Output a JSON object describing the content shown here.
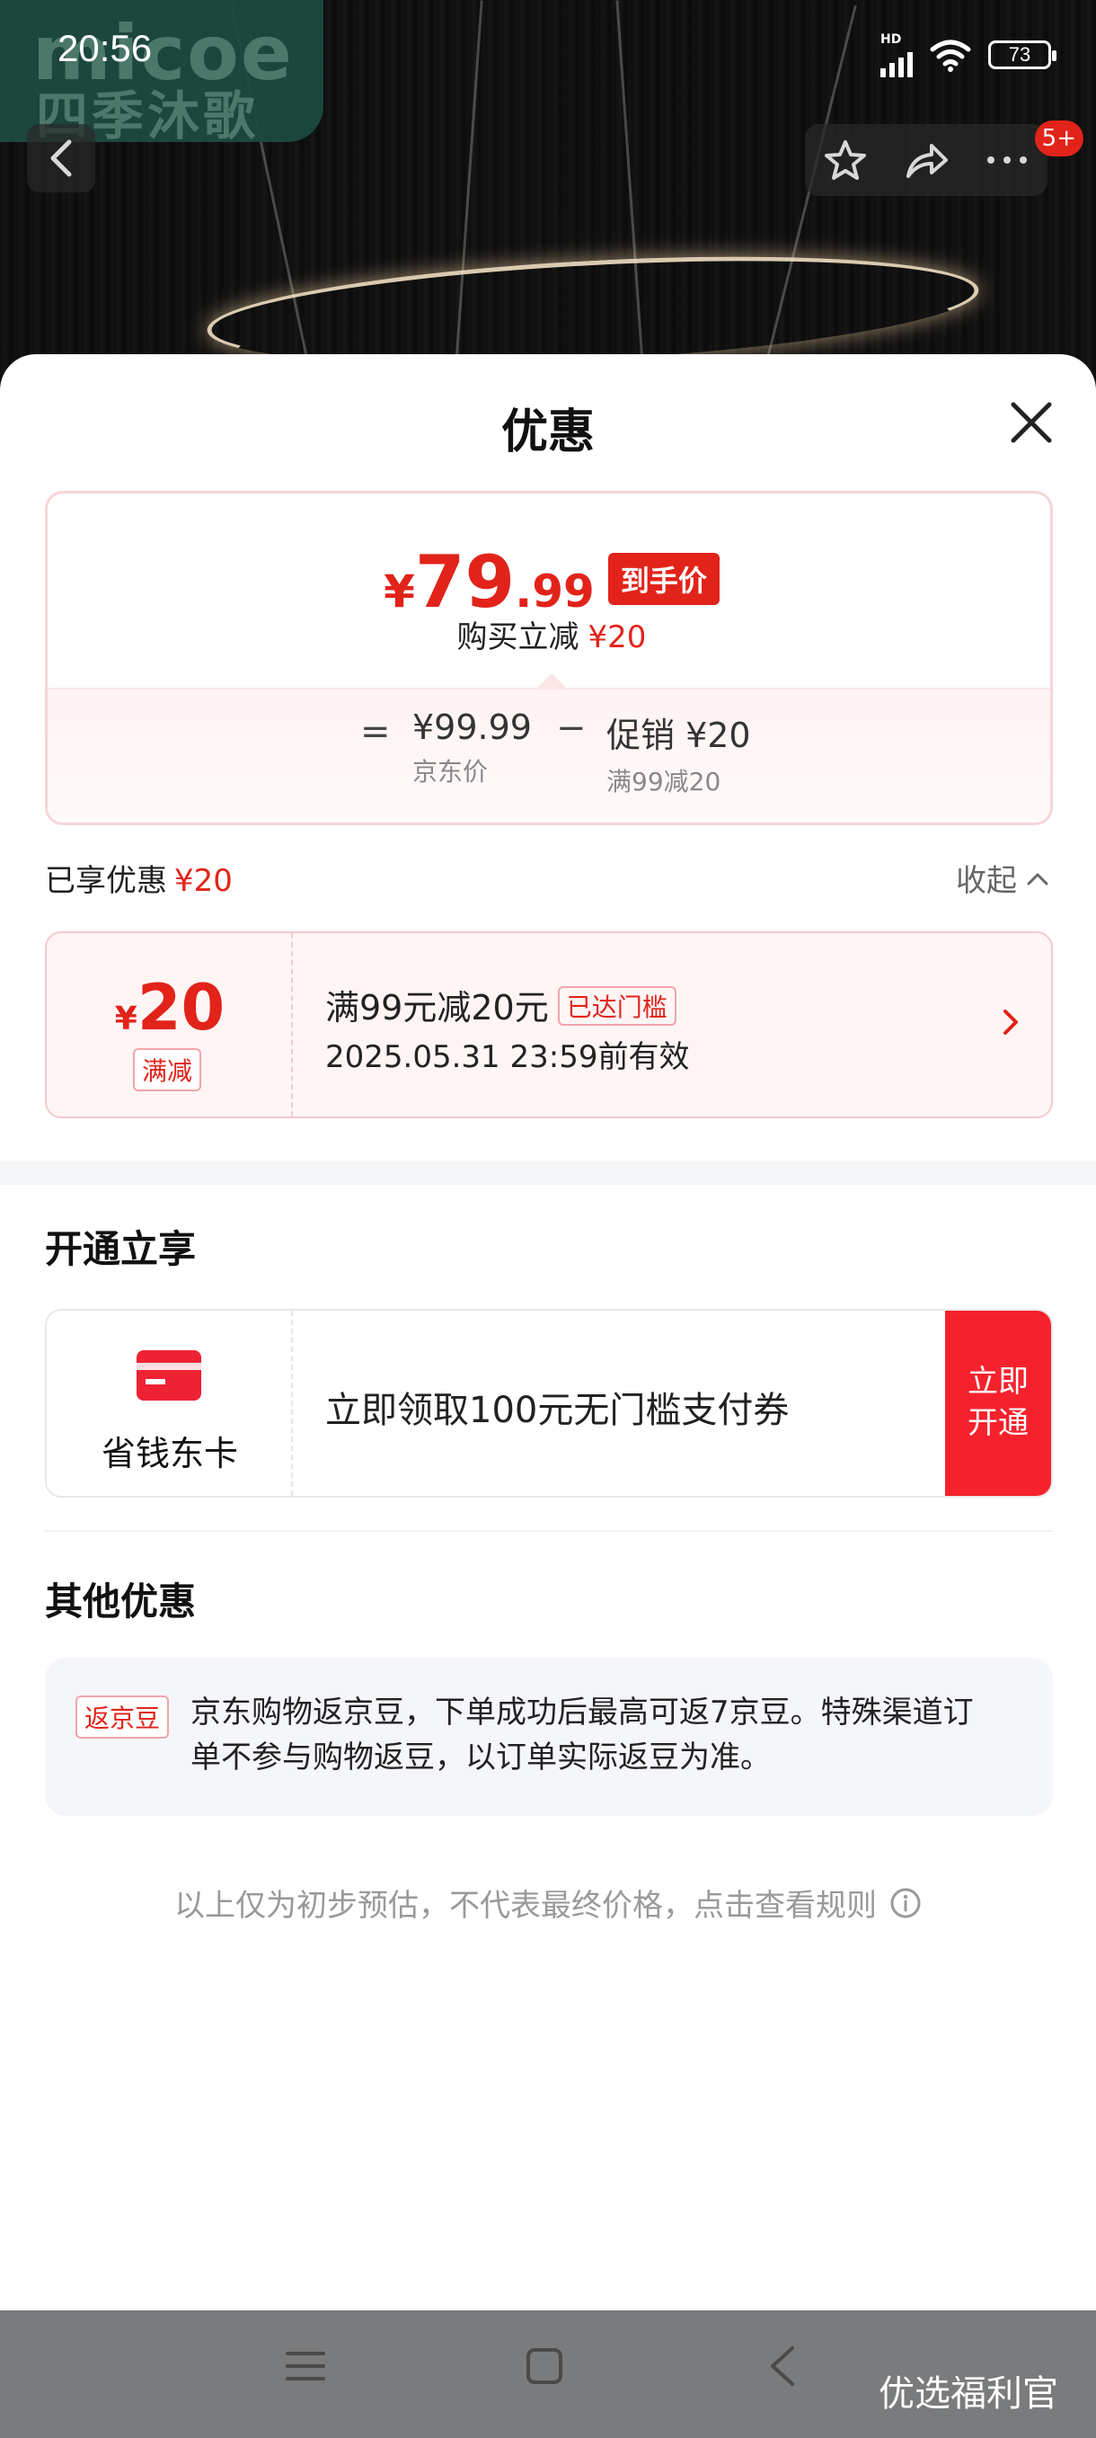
{
  "status_bar": {
    "time": "20:56",
    "network": "HD",
    "battery": "73"
  },
  "watermark": {
    "brand_en": "micoe",
    "brand_cn": "四季沐歌"
  },
  "top_nav": {
    "cart_badge": "5+"
  },
  "sheet": {
    "title": "优惠"
  },
  "price_card": {
    "currency": "¥",
    "price_int": "79",
    "price_dec": ".99",
    "hand_price_label": "到手价",
    "buy_reduce_label": "购买立减",
    "buy_reduce_value": "¥20",
    "equals": "=",
    "jd_price_value": "¥99.99",
    "jd_price_label": "京东价",
    "minus": "−",
    "promo_value": "促销 ¥20",
    "promo_label": "满99减20"
  },
  "enjoyed": {
    "label": "已享优惠",
    "value": "¥20",
    "collapse_label": "收起"
  },
  "coupon": {
    "currency": "¥",
    "amount": "20",
    "type_tag": "满减",
    "title": "满99元减20元",
    "reached_tag": "已达门槛",
    "valid_until": "2025.05.31 23:59前有效"
  },
  "open_section": {
    "heading": "开通立享",
    "card_name": "省钱东卡",
    "description": "立即领取100元无门槛支付券",
    "button_line1": "立即",
    "button_line2": "开通"
  },
  "other_section": {
    "heading": "其他优惠",
    "tag": "返京豆",
    "text": "京东购物返京豆，下单成功后最高可返7京豆。特殊渠道订单不参与购物返豆，以订单实际返豆为准。"
  },
  "rule_note": "以上仅为初步预估，不代表最终价格，点击查看规则",
  "bottom_nav": {
    "floating_label": "优选福利官"
  },
  "colors": {
    "accent_red": "#e2231a",
    "button_red": "#f5222d"
  }
}
